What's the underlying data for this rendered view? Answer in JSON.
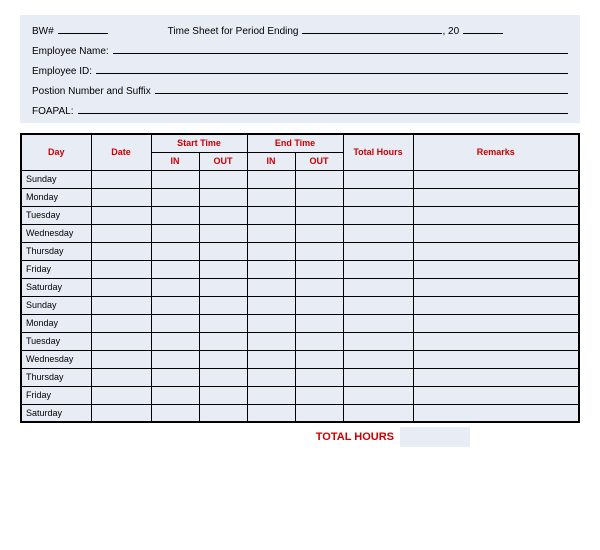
{
  "header": {
    "bw_label": "BW#",
    "title_prefix": "Time Sheet for Period Ending",
    "year_prefix": ", 20",
    "emp_name_label": "Employee Name:",
    "emp_id_label": "Employee ID:",
    "position_label": "Postion Number and Suffix",
    "foapal_label": "FOAPAL:"
  },
  "columns": {
    "day": "Day",
    "date": "Date",
    "start_time": "Start Time",
    "end_time": "End Time",
    "in": "IN",
    "out": "OUT",
    "total_hours": "Total Hours",
    "remarks": "Remarks"
  },
  "days": [
    "Sunday",
    "Monday",
    "Tuesday",
    "Wednesday",
    "Thursday",
    "Friday",
    "Saturday",
    "Sunday",
    "Monday",
    "Tuesday",
    "Wednesday",
    "Thursday",
    "Friday",
    "Saturday"
  ],
  "footer": {
    "total_hours_label": "TOTAL HOURS"
  }
}
